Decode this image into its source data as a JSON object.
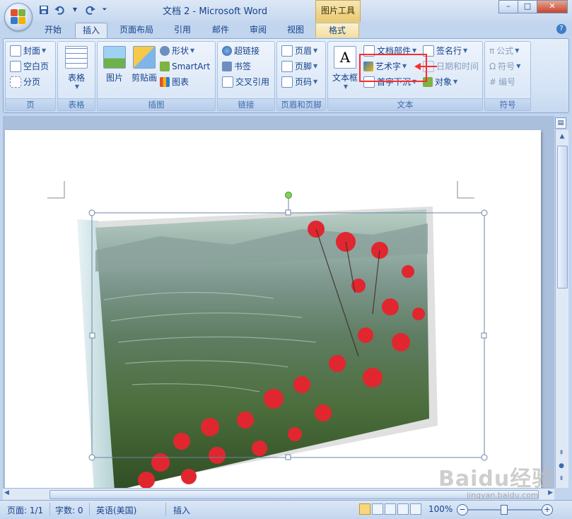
{
  "window": {
    "title": "文档 2 - Microsoft Word",
    "context_header": "图片工具",
    "controls": [
      "–",
      "□",
      "✕"
    ]
  },
  "qat": [
    "save-icon",
    "undo-icon",
    "redo-icon",
    "customize-icon"
  ],
  "tabs": [
    {
      "label": "开始",
      "active": false
    },
    {
      "label": "插入",
      "active": true
    },
    {
      "label": "页面布局",
      "active": false
    },
    {
      "label": "引用",
      "active": false
    },
    {
      "label": "邮件",
      "active": false
    },
    {
      "label": "审阅",
      "active": false
    },
    {
      "label": "视图",
      "active": false
    },
    {
      "label": "格式",
      "active": false,
      "contextual": true
    }
  ],
  "ribbon": {
    "page": {
      "label": "页",
      "cover": "封面",
      "blank": "空白页",
      "break": "分页"
    },
    "table": {
      "label": "表格",
      "table_btn": "表格"
    },
    "illustrations": {
      "label": "插图",
      "picture": "图片",
      "clipart": "剪贴画",
      "shapes": "形状",
      "smartart": "SmartArt",
      "chart": "图表"
    },
    "links": {
      "label": "链接",
      "hyperlink": "超链接",
      "bookmark": "书签",
      "crossref": "交叉引用"
    },
    "header_footer": {
      "label": "页眉和页脚",
      "header": "页眉",
      "footer": "页脚",
      "page_number": "页码"
    },
    "text": {
      "label": "文本",
      "textbox": "文本框",
      "quickparts": "文档部件",
      "wordart": "艺术字",
      "dropcap": "首字下沉",
      "signature": "签名行",
      "datetime": "日期和时间",
      "object": "对象"
    },
    "symbols": {
      "label": "符号",
      "equation": "公式",
      "symbol": "符号",
      "number": "编号"
    }
  },
  "status": {
    "page": "页面: 1/1",
    "words": "字数: 0",
    "language": "英语(美国)",
    "mode": "插入",
    "zoom": "100%"
  },
  "watermark": {
    "text": "Baidu经验",
    "sub": "jingyan.baidu.com"
  },
  "colors": {
    "accent": "#15428b",
    "highlight": "#ff2b2b",
    "ribbon": "#dce8f7"
  }
}
